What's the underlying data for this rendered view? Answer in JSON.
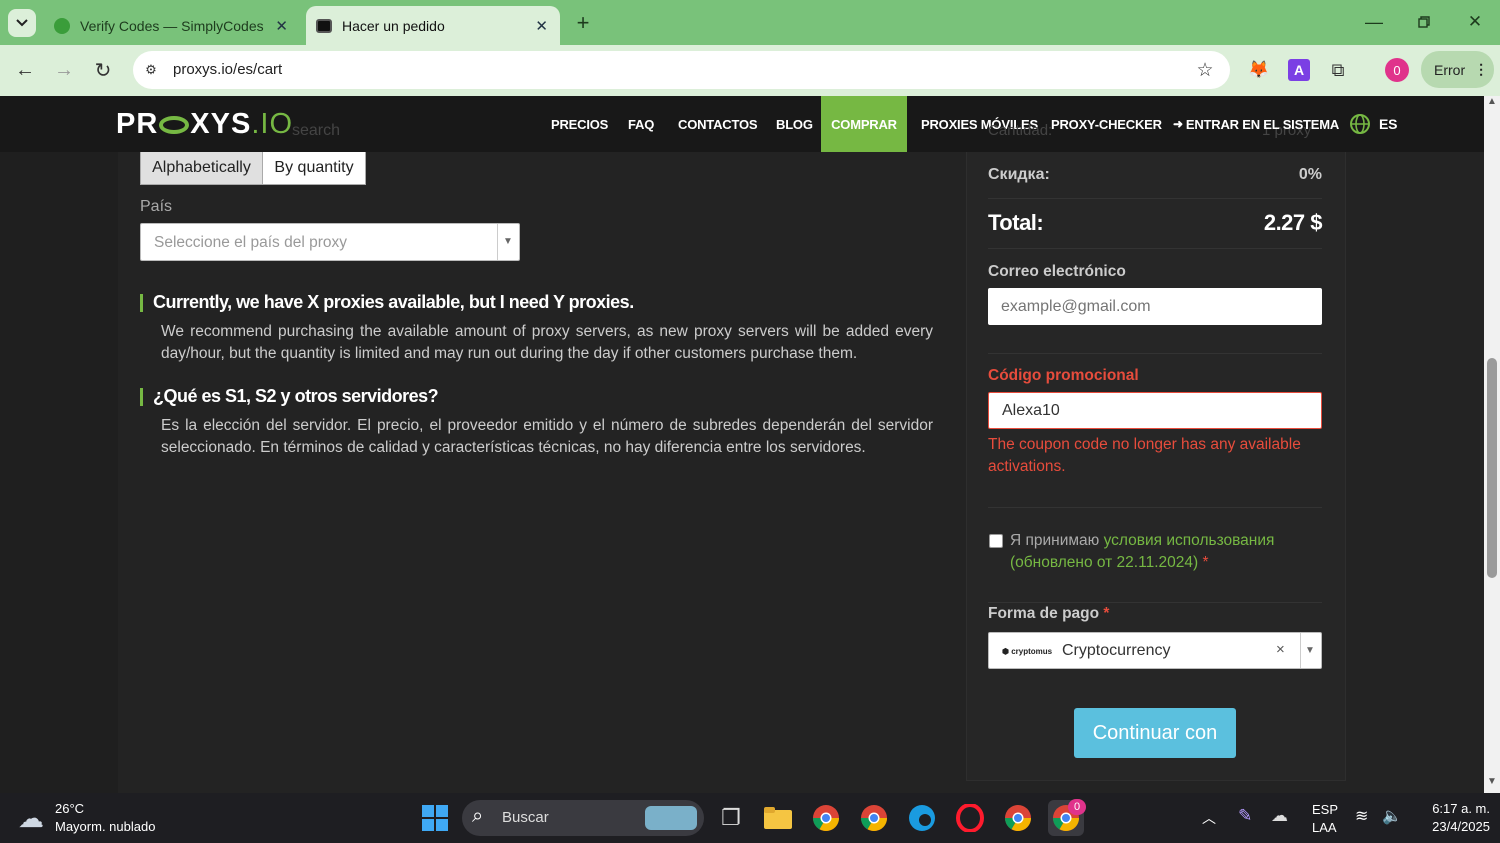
{
  "browser": {
    "tabs": [
      {
        "title": "Verify Codes — SimplyCodes",
        "icon": "simplycodes-icon"
      },
      {
        "title": "Hacer un pedido",
        "icon": "proxys-favicon-icon"
      }
    ],
    "url": "proxys.io/es/cart",
    "profile_badge": "0",
    "error_label": "Error"
  },
  "site": {
    "logo_left": "PR",
    "logo_mid": "XYS",
    "logo_right": ".IO",
    "nav": [
      "PRECIOS",
      "FAQ",
      "CONTACTOS",
      "BLOG",
      "COMPRAR",
      "PROXIES MÓVILES",
      "PROXY-CHECKER",
      "ENTRAR EN EL SISTEMA",
      "ES"
    ],
    "behind_nav_left": "search",
    "behind_nav_right_label": "Cantidad:",
    "behind_nav_right_value": "1 proxy"
  },
  "left": {
    "sort_buttons": [
      "Alphabetically",
      "By quantity"
    ],
    "country_label": "País",
    "country_placeholder": "Seleccione el país del proxy",
    "faq": [
      {
        "q": "Currently, we have X proxies available, but I need Y proxies.",
        "a": "We recommend purchasing the available amount of proxy servers, as new proxy servers will be added every day/hour, but the quantity is limited and may run out during the day if other customers purchase them."
      },
      {
        "q": "¿Qué es S1, S2 y otros servidores?",
        "a": "Es la elección del servidor. El precio, el proveedor emitido y el número de subredes dependerán del servidor seleccionado. En términos de calidad y características técnicas, no hay diferencia entre los servidores."
      }
    ]
  },
  "right": {
    "discount_label": "Скидка:",
    "discount_value": "0%",
    "total_label": "Total:",
    "total_value": "2.27 $",
    "email_label": "Correo electrónico",
    "email_placeholder": "example@gmail.com",
    "promo_label": "Código promocional",
    "promo_value": "Alexa10",
    "promo_error": "The coupon code no longer has any available activations.",
    "terms_text": "Я принимаю",
    "terms_link": "условия использования (обновлено от 22.11.2024)",
    "terms_star": "*",
    "payment_label": "Forma de pago",
    "payment_star": "*",
    "payment_brand": "cryptomus",
    "payment_value": "Cryptocurrency",
    "submit_label": "Continuar con"
  },
  "taskbar": {
    "temp": "26°C",
    "weather": "Mayorm. nublado",
    "search": "Buscar",
    "lang1": "ESP",
    "lang2": "LAA",
    "time": "6:17 a. m.",
    "date": "23/4/2025",
    "chrome_badge": "0"
  },
  "colors": {
    "accent_green": "#76b843",
    "error_red": "#e74c3c",
    "button_blue": "#5bc0de"
  }
}
